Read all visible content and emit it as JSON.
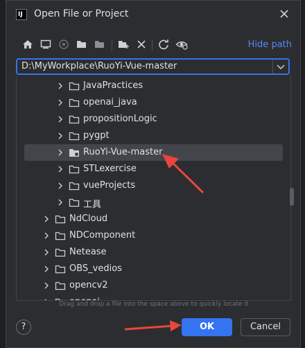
{
  "dialog": {
    "app_logo_text": "IJ",
    "title": "Open File or Project",
    "hide_path_label": "Hide path",
    "path_value": "D:\\MyWorkplace\\RuoYi-Vue-master",
    "hint_text": "Drag and drop a file into the space above to quickly locate it",
    "help_label": "?",
    "ok_label": "OK",
    "cancel_label": "Cancel"
  },
  "toolbar_icons": [
    "home-icon",
    "desktop-icon",
    "project-icon",
    "new-folder-icon",
    "module-folder-icon",
    "new-folder-plus-icon",
    "delete-icon",
    "refresh-icon",
    "show-hidden-icon"
  ],
  "tree": {
    "items": [
      {
        "label": "JavaPractices",
        "level": 2
      },
      {
        "label": "openai_java",
        "level": 2
      },
      {
        "label": "propositionLogic",
        "level": 2
      },
      {
        "label": "pygpt",
        "level": 2
      },
      {
        "label": "RuoYi-Vue-master",
        "level": 2,
        "selected": true
      },
      {
        "label": "STLexercise",
        "level": 2
      },
      {
        "label": "vueProjects",
        "level": 2
      },
      {
        "label": "工具",
        "level": 2
      },
      {
        "label": "NdCloud",
        "level": 1
      },
      {
        "label": "NDComponent",
        "level": 1
      },
      {
        "label": "Netease",
        "level": 1
      },
      {
        "label": "OBS_vedios",
        "level": 1
      },
      {
        "label": "opencv2",
        "level": 1
      },
      {
        "label": "openai",
        "level": 1
      }
    ]
  },
  "colors": {
    "accent": "#3574f0",
    "link": "#548af7",
    "annotation_arrow": "#e8463c",
    "selection": "#43454a"
  }
}
